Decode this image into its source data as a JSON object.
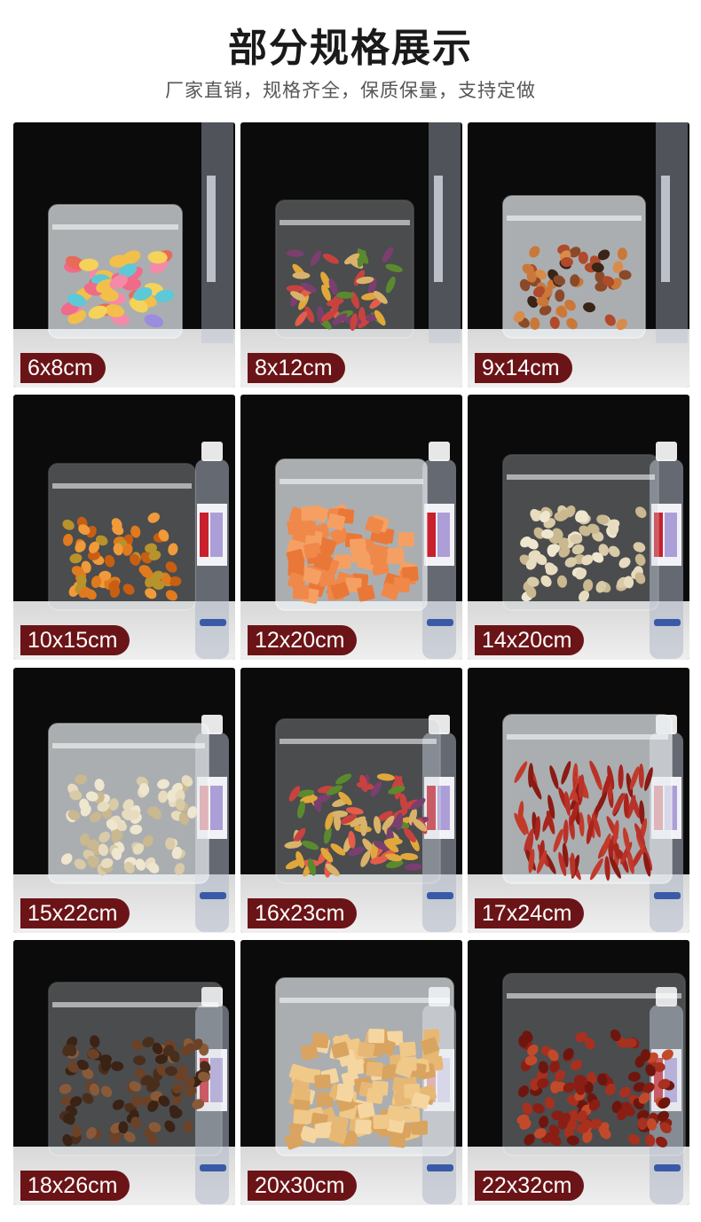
{
  "header": {
    "title": "部分规格展示",
    "subtitle": "厂家直销，规格齐全，保质保量，支持定做"
  },
  "products": [
    {
      "size": "6x8cm",
      "content": "jelly-beans",
      "bag": "frosted",
      "bottle": false
    },
    {
      "size": "8x12cm",
      "content": "vegetable-chips",
      "bag": "clear",
      "bottle": false
    },
    {
      "size": "9x14cm",
      "content": "dried-fruit",
      "bag": "frosted",
      "bottle": false
    },
    {
      "size": "10x15cm",
      "content": "dried-peach",
      "bag": "clear",
      "bottle": true
    },
    {
      "size": "12x20cm",
      "content": "crackers",
      "bag": "frosted",
      "bottle": true
    },
    {
      "size": "14x20cm",
      "content": "pistachios",
      "bag": "clear",
      "bottle": true
    },
    {
      "size": "15x22cm",
      "content": "pistachios",
      "bag": "frosted",
      "bottle": true
    },
    {
      "size": "16x23cm",
      "content": "vegetable-chips",
      "bag": "clear",
      "bottle": true
    },
    {
      "size": "17x24cm",
      "content": "chili-peppers",
      "bag": "frosted",
      "bottle": true
    },
    {
      "size": "18x26cm",
      "content": "mushrooms",
      "bag": "clear",
      "bottle": true
    },
    {
      "size": "20x30cm",
      "content": "bread-crisps",
      "bag": "frosted",
      "bottle": true
    },
    {
      "size": "22x32cm",
      "content": "red-dates",
      "bag": "clear",
      "bottle": true
    }
  ],
  "colors": {
    "label_bg": "#6b1417",
    "card_bg": "#0b0b0b"
  }
}
